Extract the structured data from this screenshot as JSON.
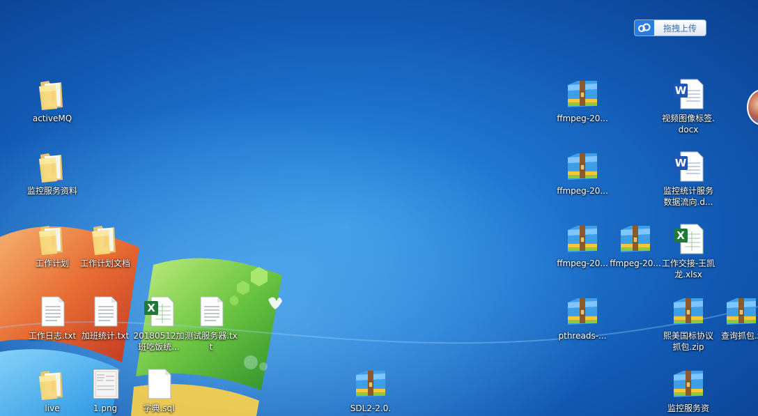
{
  "upload_widget": {
    "label": "拖拽上传",
    "icon": "cloud-icon"
  },
  "icons": [
    {
      "id": "activemq",
      "label": "activeMQ",
      "type": "folder"
    },
    {
      "id": "jkfwzl",
      "label": "监控服务资料",
      "type": "folder"
    },
    {
      "id": "gzjh",
      "label": "工作计划",
      "type": "folder"
    },
    {
      "id": "gzjhwd",
      "label": "工作计划文档",
      "type": "folder"
    },
    {
      "id": "gzrz",
      "label": "工作日志.txt",
      "type": "text"
    },
    {
      "id": "jbtj",
      "label": "加班统计.txt",
      "type": "text"
    },
    {
      "id": "xls20180512",
      "label": "20180512加班吃饭统...",
      "type": "excel"
    },
    {
      "id": "csfwq",
      "label": "测试服务器.txt",
      "type": "text"
    },
    {
      "id": "live",
      "label": "live",
      "type": "folder"
    },
    {
      "id": "png1",
      "label": "1.png",
      "type": "image"
    },
    {
      "id": "zdsql",
      "label": "字典.sql",
      "type": "blank"
    },
    {
      "id": "sdl2",
      "label": "SDL2-2.0.8....",
      "type": "archive"
    },
    {
      "id": "ffmpeg1",
      "label": "ffmpeg-20...",
      "type": "archive"
    },
    {
      "id": "ffmpeg2",
      "label": "ffmpeg-20...",
      "type": "archive"
    },
    {
      "id": "ffmpeg3",
      "label": "ffmpeg-20...",
      "type": "archive"
    },
    {
      "id": "ffmpeg4",
      "label": "ffmpeg-20...",
      "type": "archive"
    },
    {
      "id": "pthreads",
      "label": "pthreads-...",
      "type": "archive"
    },
    {
      "id": "spbq",
      "label": "视频图像标签.docx",
      "type": "word"
    },
    {
      "id": "jktj",
      "label": "监控统计服务数据流向.d...",
      "type": "word"
    },
    {
      "id": "gzjj",
      "label": "工作交接-王凯龙.xlsx",
      "type": "excel"
    },
    {
      "id": "xmgb",
      "label": "熙美国标协议抓包.zip",
      "type": "archive"
    },
    {
      "id": "cxzb",
      "label": "查询抓包.z",
      "type": "archive"
    },
    {
      "id": "jkfwz2",
      "label": "监控服务资",
      "type": "archive"
    }
  ]
}
